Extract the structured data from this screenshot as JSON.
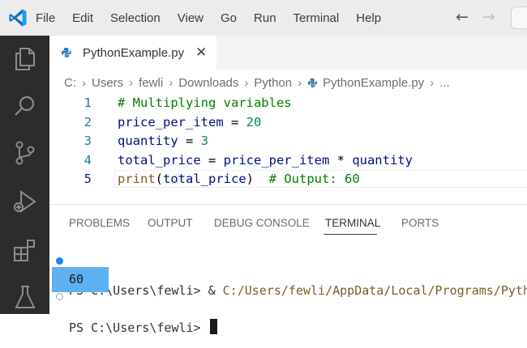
{
  "menu": {
    "items": [
      "File",
      "Edit",
      "Selection",
      "View",
      "Go",
      "Run",
      "Terminal",
      "Help"
    ]
  },
  "colors": {
    "accent": "#0078d4",
    "activitybar": "#2c2c2c",
    "terminal_highlight": "#5eb0f0"
  },
  "tab": {
    "label": "PythonExample.py",
    "icon": "python-file-icon",
    "close": "✕"
  },
  "breadcrumb": {
    "segments": [
      "C:",
      "Users",
      "fewli",
      "Downloads",
      "Python",
      "PythonExample.py",
      "..."
    ]
  },
  "code": {
    "line_numbers": [
      "1",
      "2",
      "3",
      "4",
      "5"
    ],
    "l1_comment": "# Multiplying variables",
    "l2_var": "price_per_item",
    "l2_op": " = ",
    "l2_num": "20",
    "l3_var": "quantity",
    "l3_op": " = ",
    "l3_num": "3",
    "l4_var": "total_price",
    "l4_op1": " = ",
    "l4_var2": "price_per_item",
    "l4_op2": " * ",
    "l4_var3": "quantity",
    "l5_func": "print",
    "l5_open": "(",
    "l5_arg": "total_price",
    "l5_close": ")",
    "l5_comment": "  # Output: 60"
  },
  "panel": {
    "tabs": [
      "PROBLEMS",
      "OUTPUT",
      "DEBUG CONSOLE",
      "TERMINAL",
      "PORTS"
    ],
    "active_tab": "TERMINAL"
  },
  "terminal": {
    "prompt1": "PS C:\\Users\\fewli> ",
    "cmd_amp": "& ",
    "cmd_path": "C:/Users/fewli/AppData/Local/Programs/Pyth",
    "output": "60",
    "prompt2": "PS C:\\Users\\fewli> "
  }
}
